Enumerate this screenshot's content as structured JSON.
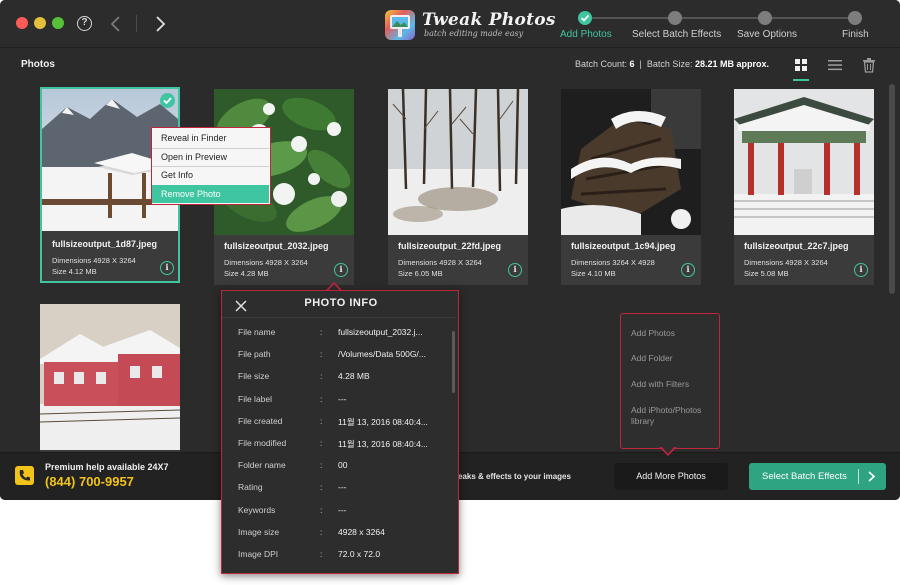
{
  "app": {
    "title": "Tweak Photos",
    "tagline": "batch editing made easy",
    "help_icon_label": "?"
  },
  "steps": [
    {
      "label": "Add Photos",
      "state": "done"
    },
    {
      "label": "Select Batch Effects",
      "state": "pending"
    },
    {
      "label": "Save Options",
      "state": "pending"
    },
    {
      "label": "Finish",
      "state": "pending"
    }
  ],
  "toolbar": {
    "title": "Photos",
    "batch_count_label": "Batch Count:",
    "batch_count": "6",
    "batch_size_label": "Batch Size:",
    "batch_size": "28.21 MB approx.",
    "separator": "|"
  },
  "photos": [
    {
      "name": "fullsizeoutput_1d87.jpeg",
      "dimensions": "Dimensions 4928 X 3264",
      "size": "Size 4.12 MB",
      "selected": true,
      "scene": "mountain-snow-hut"
    },
    {
      "name": "fullsizeoutput_2032.jpeg",
      "dimensions": "Dimensions 4928 X 3264",
      "size": "Size 4.28 MB",
      "selected": false,
      "scene": "snowy-leaves"
    },
    {
      "name": "fullsizeoutput_22fd.jpeg",
      "dimensions": "Dimensions 4928 X 3264",
      "size": "Size 6.05 MB",
      "selected": false,
      "scene": "snowy-forest"
    },
    {
      "name": "fullsizeoutput_1c94.jpeg",
      "dimensions": "Dimensions 3264 X 4928",
      "size": "Size 4.10 MB",
      "selected": false,
      "scene": "snowy-waterwheel"
    },
    {
      "name": "fullsizeoutput_22c7.jpeg",
      "dimensions": "Dimensions 4928 X 3264",
      "size": "Size 5.08 MB",
      "selected": false,
      "scene": "pavilion"
    },
    {
      "name": "",
      "dimensions": "",
      "size": "",
      "selected": false,
      "scene": "pink-house"
    }
  ],
  "info_button_glyph": "i",
  "context_menu": {
    "items": [
      {
        "label": "Reveal in Finder",
        "highlighted": false
      },
      {
        "label": "Open in Preview",
        "highlighted": false
      },
      {
        "label": "Get Info",
        "highlighted": false
      },
      {
        "label": "Remove Photo",
        "highlighted": true
      }
    ]
  },
  "photo_info": {
    "title": "PHOTO INFO",
    "rows": [
      {
        "key": "File name",
        "value": "fullsizeoutput_2032.j..."
      },
      {
        "key": "File path",
        "value": "/Volumes/Data 500G/..."
      },
      {
        "key": "File size",
        "value": "4.28 MB"
      },
      {
        "key": "File label",
        "value": "---"
      },
      {
        "key": "File created",
        "value": "11월 13, 2016 08:40:4..."
      },
      {
        "key": "File modified",
        "value": "11월 13, 2016 08:40:4..."
      },
      {
        "key": "Folder name",
        "value": "00"
      },
      {
        "key": "Rating",
        "value": "---"
      },
      {
        "key": "Keywords",
        "value": "---"
      },
      {
        "key": "Image size",
        "value": "4928 x 3264"
      },
      {
        "key": "Image DPI",
        "value": "72.0 x 72.0"
      }
    ],
    "colon": ":"
  },
  "add_menu": {
    "items": [
      "Add Photos",
      "Add Folder",
      "Add with Filters",
      "Add iPhoto/Photos library"
    ]
  },
  "bottom": {
    "help_text": "Premium help available 24X7",
    "phone": "(844) 700-9957",
    "tagline": "eaks & effects to your images",
    "add_more_label": "Add More Photos",
    "select_batch_label": "Select Batch Effects"
  },
  "colors": {
    "accent": "#3fc6a0",
    "highlight_border": "#c0253e",
    "phone_yellow": "#f2c318"
  }
}
